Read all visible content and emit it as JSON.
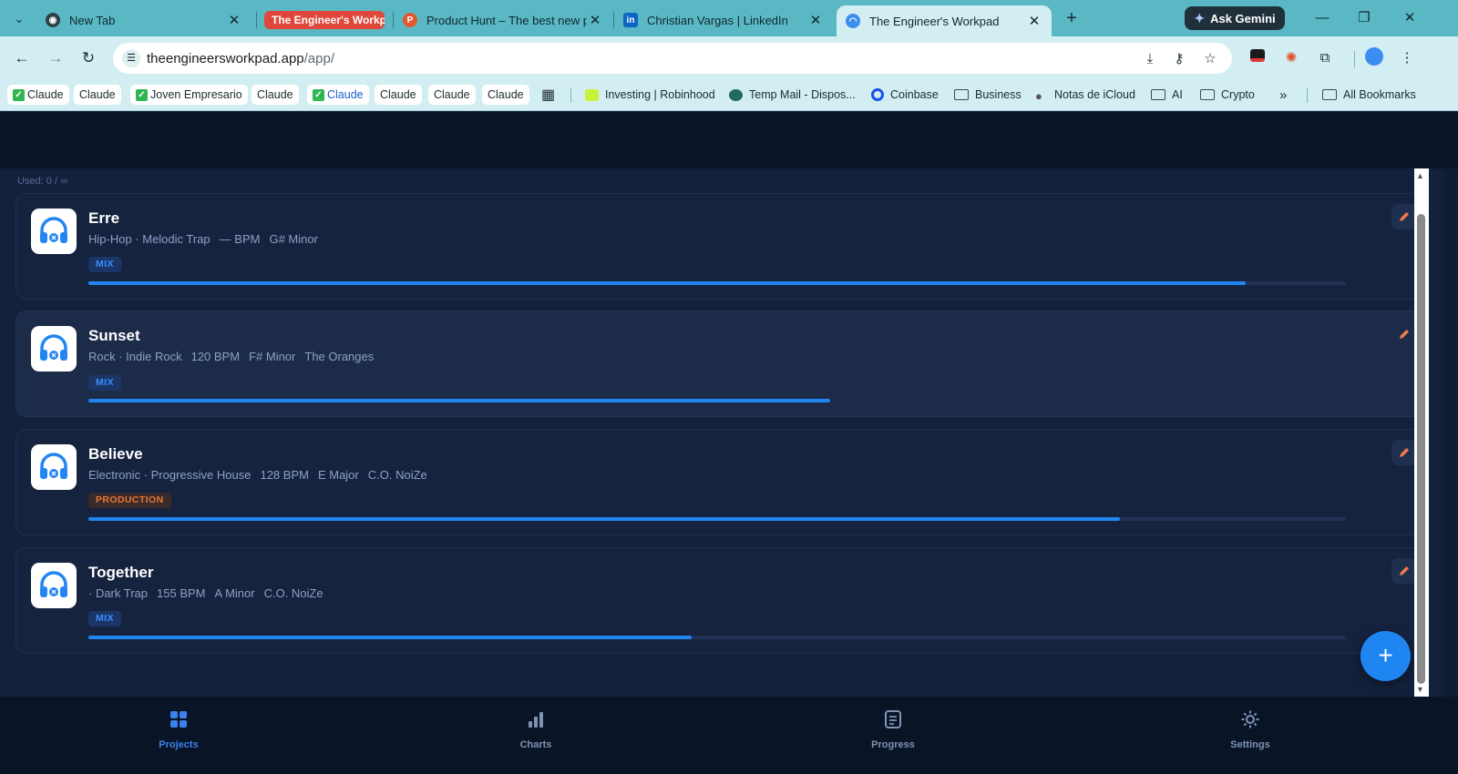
{
  "browser": {
    "tabs": [
      {
        "title": "New Tab",
        "icon": "chrome-icon"
      },
      {
        "title": "The Engineer's Workpad",
        "icon": "tab-group-chip",
        "grouped": true
      },
      {
        "title": "Product Hunt – The best new products",
        "icon": "product-hunt-icon"
      },
      {
        "title": "Christian Vargas | LinkedIn",
        "icon": "linkedin-icon"
      },
      {
        "title": "The Engineer's Workpad",
        "icon": "workpad-icon",
        "active": true
      }
    ],
    "gemini_label": "Ask Gemini",
    "url_host": "theengineersworkpad.app",
    "url_path": "/app/",
    "bookmarks": [
      {
        "label": "Claude",
        "check": true
      },
      {
        "label": "Claude"
      },
      {
        "label": "Joven Empresario",
        "check": true
      },
      {
        "label": "Claude"
      },
      {
        "label": "Claude",
        "check": true,
        "blue": true
      },
      {
        "label": "Claude"
      },
      {
        "label": "Claude"
      },
      {
        "label": "Claude"
      },
      {
        "label": "Investing | Robinhood"
      },
      {
        "label": "Temp Mail - Dispos..."
      },
      {
        "label": "Coinbase"
      },
      {
        "label": "Business"
      },
      {
        "label": "Notas de iCloud"
      },
      {
        "label": "AI"
      },
      {
        "label": "Crypto"
      },
      {
        "label": "All Bookmarks"
      }
    ]
  },
  "app": {
    "usage": "Used: 0 / ∞",
    "projects": [
      {
        "name": "Erre",
        "meta": [
          "Hip-Hop · Melodic Trap",
          "— BPM",
          "G# Minor"
        ],
        "stage": "MIX",
        "progress": 0.92
      },
      {
        "name": "Sunset",
        "meta": [
          "Rock · Indie Rock",
          "120 BPM",
          "F# Minor",
          "The Oranges"
        ],
        "stage": "MIX",
        "progress": 0.59
      },
      {
        "name": "Believe",
        "meta": [
          "Electronic · Progressive House",
          "128 BPM",
          "E Major",
          "C.O. NoiZe"
        ],
        "stage": "PRODUCTION",
        "progress": 0.82
      },
      {
        "name": "Together",
        "meta": [
          "· Dark Trap",
          "155 BPM",
          "A Minor",
          "C.O. NoiZe"
        ],
        "stage": "MIX",
        "progress": 0.48
      }
    ],
    "fab_label": "+",
    "nav": [
      {
        "label": "Projects",
        "icon": "grid-icon",
        "active": true
      },
      {
        "label": "Charts",
        "icon": "bar-chart-icon"
      },
      {
        "label": "Progress",
        "icon": "document-icon"
      },
      {
        "label": "Settings",
        "icon": "gear-icon"
      }
    ]
  },
  "colors": {
    "accent": "#2286f2",
    "mix_badge": "#3d8eff",
    "production_badge": "#e57836",
    "edit_icon": "#f27a4a",
    "tab_bar": "#5ab8c5",
    "app_bg": "#13213c"
  }
}
